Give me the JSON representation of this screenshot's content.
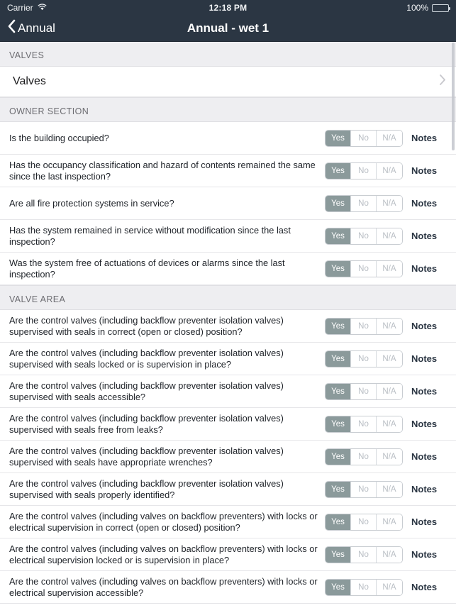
{
  "status_bar": {
    "carrier": "Carrier",
    "wifi_icon": "wifi-icon",
    "time": "12:18 PM",
    "battery_percent": "100%",
    "battery_icon": "battery-full-icon"
  },
  "nav_bar": {
    "back_icon": "chevron-left-icon",
    "back_label": "Annual",
    "title": "Annual - wet 1"
  },
  "colors": {
    "navbar_bg": "#2b3643",
    "section_header_bg": "#eeeef1",
    "segment_selected_bg": "#8b9a9b",
    "notes_text": "#2b3643"
  },
  "segment_options": [
    "Yes",
    "No",
    "N/A"
  ],
  "notes_label": "Notes",
  "sections": [
    {
      "header": "VALVES",
      "type": "nav",
      "rows": [
        {
          "label": "Valves",
          "disclosure_icon": "chevron-right-icon"
        }
      ]
    },
    {
      "header": "OWNER SECTION",
      "type": "questions",
      "rows": [
        {
          "question": "Is the building occupied?",
          "answer": "Yes"
        },
        {
          "question": "Has the occupancy classification and hazard of contents remained the same since the last inspection?",
          "answer": "Yes"
        },
        {
          "question": "Are all fire protection systems in service?",
          "answer": "Yes"
        },
        {
          "question": "Has the system remained in service without modification since the last inspection?",
          "answer": "Yes"
        },
        {
          "question": "Was the system free of actuations of devices or alarms since the last inspection?",
          "answer": "Yes"
        }
      ]
    },
    {
      "header": "VALVE AREA",
      "type": "questions",
      "rows": [
        {
          "question": "Are the control valves (including backflow preventer isolation valves) supervised with seals in correct (open or closed) position?",
          "answer": "Yes"
        },
        {
          "question": "Are the control valves (including backflow preventer isolation valves) supervised with seals locked or is supervision in place?",
          "answer": "Yes"
        },
        {
          "question": "Are the control valves (including backflow preventer isolation valves) supervised with seals accessible?",
          "answer": "Yes"
        },
        {
          "question": "Are the control valves (including backflow preventer isolation valves) supervised with seals free from leaks?",
          "answer": "Yes"
        },
        {
          "question": "Are the control valves (including backflow preventer isolation valves) supervised with seals have appropriate wrenches?",
          "answer": "Yes"
        },
        {
          "question": "Are the control valves (including backflow preventer isolation valves) supervised with seals properly identified?",
          "answer": "Yes"
        },
        {
          "question": "Are the control valves (including valves on backflow preventers) with locks or electrical supervision in correct (open or closed) position?",
          "answer": "Yes"
        },
        {
          "question": "Are the control valves (including valves on backflow preventers) with locks or electrical supervision locked or is supervision in place?",
          "answer": "Yes"
        },
        {
          "question": "Are the control valves (including valves on backflow preventers) with locks or electrical supervision accessible?",
          "answer": "Yes"
        }
      ]
    }
  ]
}
